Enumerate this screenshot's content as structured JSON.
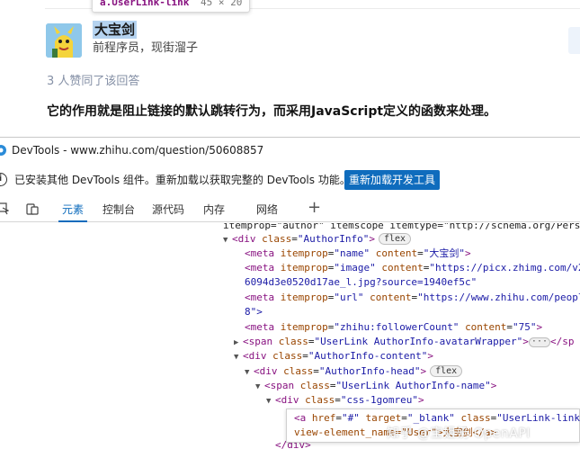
{
  "page": {
    "tooltip_tag": "a.UserLink-link",
    "tooltip_dims": "45 × 20",
    "author_name": "大宝剑",
    "author_headline": "前程序员，现街溜子",
    "votes": "3 人赞同了该回答",
    "answer_text": "它的作用就是阻止链接的默认跳转行为，而采用JavaScript定义的函数来处理。"
  },
  "devtools": {
    "title": "DevTools - www.zhihu.com/question/50608857",
    "info_text": "已安装其他 DevTools 组件。重新加载以获取完整的 DevTools 功能。",
    "reload_button": "重新加载开发工具",
    "tabs": [
      "元素",
      "控制台",
      "源代码",
      "内存",
      "网络"
    ],
    "active_tab": "元素",
    "plus": "+"
  },
  "tree": {
    "l0": "itemprop=\"author\" itemscope itemtype=\"http://schema.org/Pers",
    "l1_tag": "<div",
    "l1_attr": "class",
    "l1_val": "\"AuthorInfo\"",
    "l1_close": ">",
    "badge_flex": "flex",
    "l2_name": "\"name\"",
    "l2_content": "\"大宝剑\"",
    "l3_name": "\"image\"",
    "l3_content": "\"https://picx.zhimg.com/v2",
    "l3b": "6094d3e0520d17ae_l.jpg?source=1940ef5c\"",
    "l4_name": "\"url\"",
    "l4_content": "\"https://www.zhihu.com/peopl",
    "l4b": "8\">",
    "l5_name": "\"zhihu:followerCount\"",
    "l5_content": "\"75\"",
    "l6_val": "\"UserLink AuthorInfo-avatarWrapper\"",
    "l6_end": "</sp",
    "l7_val": "\"AuthorInfo-content\"",
    "l8_val": "\"AuthorInfo-head\"",
    "l9_val": "\"UserLink AuthorInfo-name\"",
    "l10_val": "\"css-1gomreu\"",
    "h1_href": "\"#\"",
    "h1_target": "\"_blank\"",
    "h1_class": "\"UserLink-link\"",
    "h2": "view-element_name=\"User\">大宝剑</a>",
    "l_close": "</div>",
    "ellipsis": "···"
  },
  "watermark": "知乎 @宝姐奶 OpenAPI",
  "colors": {
    "accent": "#0f6cbd",
    "tag": "#881280",
    "attr_name": "#994500",
    "attr_value": "#1a1aa6"
  }
}
